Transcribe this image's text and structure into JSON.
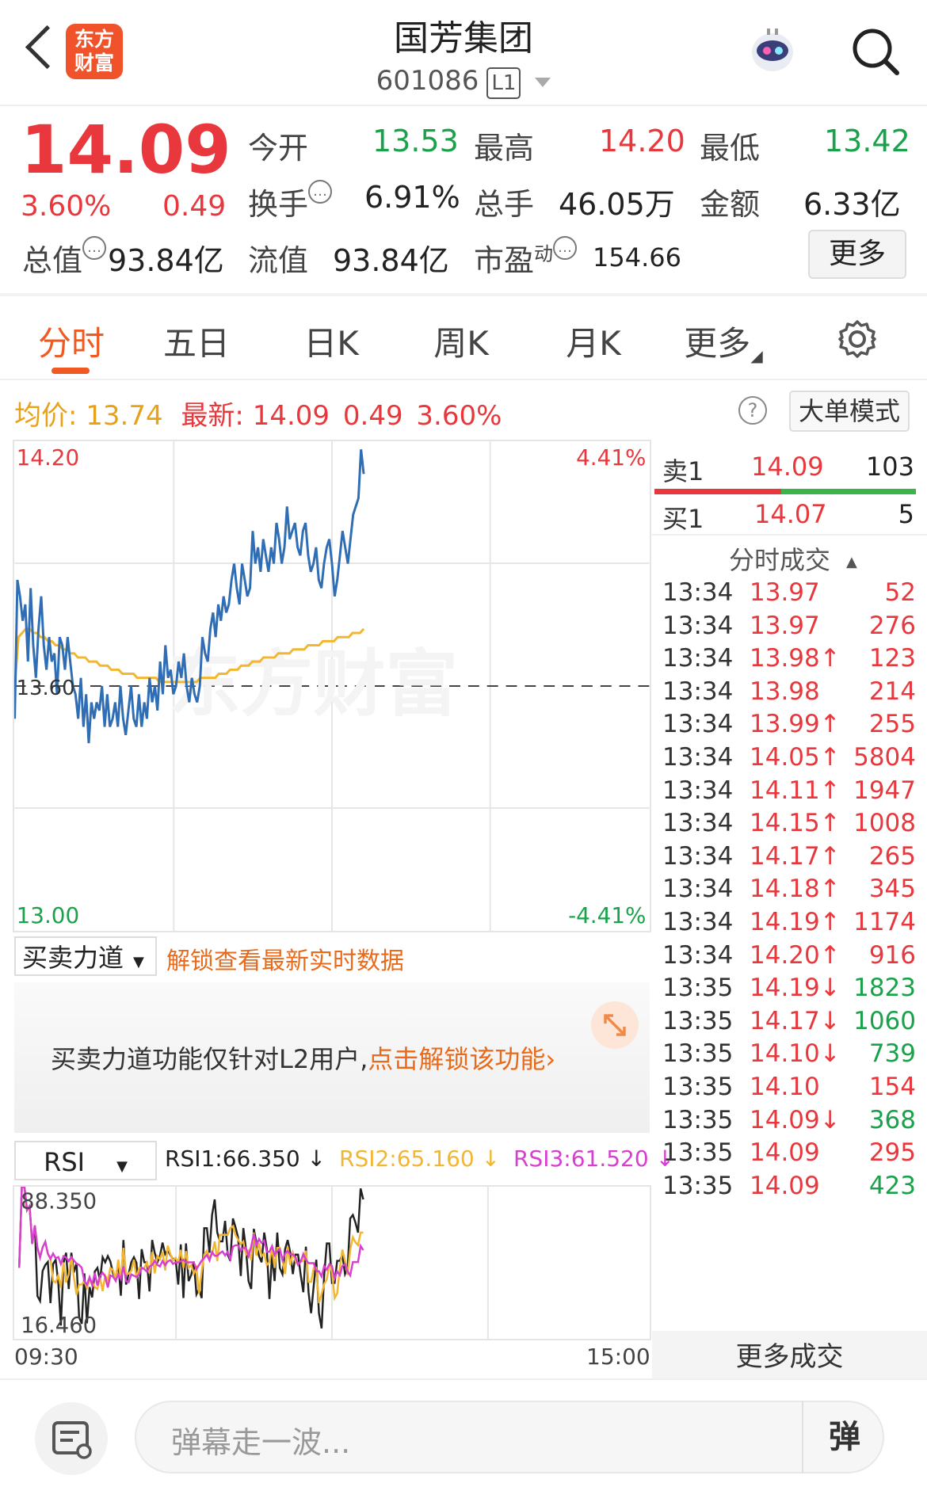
{
  "header": {
    "logo_line1": "东方",
    "logo_line2": "财富",
    "title": "国芳集团",
    "code": "601086",
    "level_tag": "L1"
  },
  "quote": {
    "price": "14.09",
    "change_pct": "3.60%",
    "change": "0.49",
    "fields": [
      {
        "label": "今开",
        "value": "13.53",
        "color": "green"
      },
      {
        "label": "最高",
        "value": "14.20",
        "color": "red"
      },
      {
        "label": "最低",
        "value": "13.42",
        "color": "green"
      },
      {
        "label": "换手",
        "value": "6.91%",
        "color": "dark"
      },
      {
        "label": "总手",
        "value": "46.05万",
        "color": "dark"
      },
      {
        "label": "金额",
        "value": "6.33亿",
        "color": "dark"
      },
      {
        "label": "总值",
        "value": "93.84亿",
        "color": "dark"
      },
      {
        "label": "流值",
        "value": "93.84亿",
        "color": "dark"
      },
      {
        "label": "市盈",
        "value": "154.66",
        "color": "dark"
      }
    ],
    "pe_sup": "动",
    "more_label": "更多"
  },
  "tabs": [
    "分时",
    "五日",
    "日K",
    "周K",
    "月K",
    "更多"
  ],
  "info_line": {
    "avg_label": "均价:",
    "avg_value": "13.74",
    "latest_label": "最新:",
    "latest_price": "14.09",
    "latest_change": "0.49",
    "latest_pct": "3.60%",
    "help": "?",
    "big_order_mode": "大单模式"
  },
  "colors": {
    "red": "#e8383d",
    "green": "#1aa24b",
    "accent": "#f05a22",
    "avg_line": "#f2b630",
    "price_line": "#2f6eb5"
  },
  "chart_data": {
    "type": "line",
    "ylim": [
      13.0,
      14.2
    ],
    "y_top_label": "14.20",
    "y_bottom_label": "13.00",
    "y_mid_label": "13.60",
    "pct_top_label": "4.41%",
    "pct_bottom_label": "-4.41%",
    "x_start_label": "09:30",
    "x_end_label": "15:00",
    "total_minutes": 240,
    "prev_close": 13.6,
    "series": [
      {
        "key": "price",
        "values": [
          13.52,
          13.86,
          13.82,
          13.76,
          13.8,
          13.66,
          13.84,
          13.7,
          13.62,
          13.74,
          13.82,
          13.7,
          13.64,
          13.72,
          13.66,
          13.68,
          13.58,
          13.72,
          13.7,
          13.64,
          13.72,
          13.66,
          13.6,
          13.58,
          13.52,
          13.62,
          13.5,
          13.58,
          13.46,
          13.56,
          13.52,
          13.56,
          13.54,
          13.6,
          13.5,
          13.58,
          13.5,
          13.52,
          13.56,
          13.5,
          13.6,
          13.52,
          13.48,
          13.54,
          13.6,
          13.52,
          13.5,
          13.58,
          13.5,
          13.56,
          13.52,
          13.62,
          13.56,
          13.6,
          13.54,
          13.66,
          13.58,
          13.7,
          13.62,
          13.64,
          13.58,
          13.6,
          13.66,
          13.62,
          13.68,
          13.6,
          13.56,
          13.62,
          13.58,
          13.56,
          13.6,
          13.72,
          13.68,
          13.66,
          13.74,
          13.78,
          13.72,
          13.8,
          13.76,
          13.82,
          13.78,
          13.8,
          13.86,
          13.9,
          13.84,
          13.8,
          13.9,
          13.86,
          13.82,
          13.84,
          13.98,
          13.9,
          13.94,
          13.88,
          13.96,
          13.92,
          13.88,
          13.94,
          13.9,
          14.0,
          13.96,
          13.9,
          13.94,
          14.04,
          13.96,
          13.98,
          14.0,
          13.94,
          13.92,
          13.98,
          14.0,
          13.92,
          13.88,
          13.9,
          13.94,
          13.86,
          13.84,
          13.9,
          13.94,
          13.96,
          13.9,
          13.82,
          13.86,
          13.92,
          13.98,
          13.94,
          13.9,
          13.96,
          14.02,
          14.04,
          14.06,
          14.18,
          14.12
        ]
      },
      {
        "key": "avg",
        "values": [
          13.6,
          13.72,
          13.73,
          13.74,
          13.74,
          13.73,
          13.73,
          13.72,
          13.72,
          13.71,
          13.71,
          13.7,
          13.7,
          13.69,
          13.69,
          13.68,
          13.68,
          13.67,
          13.67,
          13.67,
          13.66,
          13.66,
          13.66,
          13.65,
          13.65,
          13.65,
          13.64,
          13.64,
          13.64,
          13.63,
          13.63,
          13.63,
          13.63,
          13.62,
          13.62,
          13.62,
          13.62,
          13.62,
          13.62,
          13.61,
          13.61,
          13.61,
          13.61,
          13.61,
          13.61,
          13.61,
          13.61,
          13.61,
          13.61,
          13.61,
          13.62,
          13.62,
          13.62,
          13.62,
          13.62,
          13.63,
          13.63,
          13.63,
          13.64,
          13.64,
          13.64,
          13.65,
          13.65,
          13.65,
          13.66,
          13.66,
          13.66,
          13.67,
          13.67,
          13.67,
          13.67,
          13.68,
          13.68,
          13.68,
          13.68,
          13.69,
          13.69,
          13.69,
          13.69,
          13.7,
          13.7,
          13.7,
          13.7,
          13.71,
          13.71,
          13.71,
          13.71,
          13.72,
          13.72,
          13.72,
          13.72,
          13.73,
          13.73,
          13.73,
          13.74
        ]
      }
    ]
  },
  "order_book": {
    "sell_label": "卖1",
    "sell_price": "14.09",
    "sell_qty": "103",
    "buy_label": "买1",
    "buy_price": "14.07",
    "buy_qty": "5"
  },
  "trades_title": "分时成交",
  "trades": [
    {
      "time": "13:34",
      "price": "13.97",
      "arrow": "",
      "vol": "52",
      "pc": "red",
      "vc": "red"
    },
    {
      "time": "13:34",
      "price": "13.97",
      "arrow": "",
      "vol": "276",
      "pc": "red",
      "vc": "red"
    },
    {
      "time": "13:34",
      "price": "13.98",
      "arrow": "↑",
      "vol": "123",
      "pc": "red",
      "vc": "red"
    },
    {
      "time": "13:34",
      "price": "13.98",
      "arrow": "",
      "vol": "214",
      "pc": "red",
      "vc": "red"
    },
    {
      "time": "13:34",
      "price": "13.99",
      "arrow": "↑",
      "vol": "255",
      "pc": "red",
      "vc": "red"
    },
    {
      "time": "13:34",
      "price": "14.05",
      "arrow": "↑",
      "vol": "5804",
      "pc": "red",
      "vc": "red"
    },
    {
      "time": "13:34",
      "price": "14.11",
      "arrow": "↑",
      "vol": "1947",
      "pc": "red",
      "vc": "red"
    },
    {
      "time": "13:34",
      "price": "14.15",
      "arrow": "↑",
      "vol": "1008",
      "pc": "red",
      "vc": "red"
    },
    {
      "time": "13:34",
      "price": "14.17",
      "arrow": "↑",
      "vol": "265",
      "pc": "red",
      "vc": "red"
    },
    {
      "time": "13:34",
      "price": "14.18",
      "arrow": "↑",
      "vol": "345",
      "pc": "red",
      "vc": "red"
    },
    {
      "time": "13:34",
      "price": "14.19",
      "arrow": "↑",
      "vol": "1174",
      "pc": "red",
      "vc": "red"
    },
    {
      "time": "13:34",
      "price": "14.20",
      "arrow": "↑",
      "vol": "916",
      "pc": "red",
      "vc": "red"
    },
    {
      "time": "13:35",
      "price": "14.19",
      "arrow": "↓",
      "vol": "1823",
      "pc": "red",
      "vc": "green"
    },
    {
      "time": "13:35",
      "price": "14.17",
      "arrow": "↓",
      "vol": "1060",
      "pc": "red",
      "vc": "green"
    },
    {
      "time": "13:35",
      "price": "14.10",
      "arrow": "↓",
      "vol": "739",
      "pc": "red",
      "vc": "green"
    },
    {
      "time": "13:35",
      "price": "14.10",
      "arrow": "",
      "vol": "154",
      "pc": "red",
      "vc": "red"
    },
    {
      "time": "13:35",
      "price": "14.09",
      "arrow": "↓",
      "vol": "368",
      "pc": "red",
      "vc": "green"
    },
    {
      "time": "13:35",
      "price": "14.09",
      "arrow": "",
      "vol": "295",
      "pc": "red",
      "vc": "red"
    },
    {
      "time": "13:35",
      "price": "14.09",
      "arrow": "",
      "vol": "423",
      "pc": "red",
      "vc": "green"
    }
  ],
  "more_trades": "更多成交",
  "force": {
    "selector": "买卖力道",
    "unlock_link": "解锁查看最新实时数据",
    "lock_text": "买卖力道功能仅针对L2用户,",
    "lock_link": "点击解锁该功能"
  },
  "rsi": {
    "selector": "RSI",
    "rsi1": "RSI1:66.350 ↓",
    "rsi2": "RSI2:65.160 ↓",
    "rsi3": "RSI3:61.520 ↓",
    "y_top_label": "88.350",
    "y_bottom_label": "16.460",
    "ylim": [
      16.46,
      88.35
    ]
  },
  "bottom": {
    "placeholder": "弹幕走一波...",
    "danmu_btn": "弹"
  }
}
